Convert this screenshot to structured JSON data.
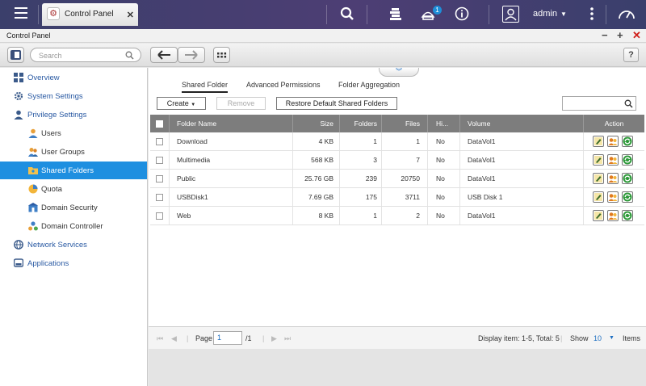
{
  "taskbar": {
    "tab_label": "Control Panel",
    "notification_count": "1",
    "user": "admin"
  },
  "window": {
    "title": "Control Panel"
  },
  "toolbar": {
    "search_placeholder": "Search",
    "help_label": "?"
  },
  "sidebar": {
    "items": [
      {
        "label": "Overview",
        "icon": "overview-icon"
      },
      {
        "label": "System Settings",
        "icon": "gear-icon"
      },
      {
        "label": "Privilege Settings",
        "icon": "person-icon"
      },
      {
        "label": "Users",
        "icon": "user-icon"
      },
      {
        "label": "User Groups",
        "icon": "user-group-icon"
      },
      {
        "label": "Shared Folders",
        "icon": "shared-folder-icon"
      },
      {
        "label": "Quota",
        "icon": "quota-pie-icon"
      },
      {
        "label": "Domain Security",
        "icon": "domain-security-icon"
      },
      {
        "label": "Domain Controller",
        "icon": "domain-controller-icon"
      },
      {
        "label": "Network Services",
        "icon": "globe-icon"
      },
      {
        "label": "Applications",
        "icon": "applications-icon"
      }
    ],
    "active": "Shared Folders"
  },
  "main": {
    "tabs": [
      {
        "label": "Shared Folder"
      },
      {
        "label": "Advanced Permissions"
      },
      {
        "label": "Folder Aggregation"
      }
    ],
    "buttons": {
      "create": "Create",
      "remove": "Remove",
      "restore": "Restore Default Shared Folders"
    },
    "table": {
      "headers": [
        "Folder Name",
        "Size",
        "Folders",
        "Files",
        "Hi...",
        "Volume",
        "Action"
      ],
      "rows": [
        {
          "name": "Download",
          "size": "4 KB",
          "folders": "1",
          "files": "1",
          "hidden": "No",
          "volume": "DataVol1"
        },
        {
          "name": "Multimedia",
          "size": "568 KB",
          "folders": "3",
          "files": "7",
          "hidden": "No",
          "volume": "DataVol1"
        },
        {
          "name": "Public",
          "size": "25.76 GB",
          "folders": "239",
          "files": "20750",
          "hidden": "No",
          "volume": "DataVol1"
        },
        {
          "name": "USBDisk1",
          "size": "7.69 GB",
          "folders": "175",
          "files": "3711",
          "hidden": "No",
          "volume": "USB Disk 1"
        },
        {
          "name": "Web",
          "size": "8 KB",
          "folders": "1",
          "files": "2",
          "hidden": "No",
          "volume": "DataVol1"
        }
      ]
    },
    "pager": {
      "page_label": "Page",
      "page_value": "1",
      "page_total": "/1",
      "display": "Display item: 1-5, Total: 5",
      "show_label": "Show",
      "show_value": "10",
      "items_label": "Items"
    }
  },
  "colors": {
    "topbar": "#3b3f6b",
    "active_nav": "#1e8fe0",
    "link": "#2a5aa3",
    "table_header": "#7d7d7d"
  }
}
